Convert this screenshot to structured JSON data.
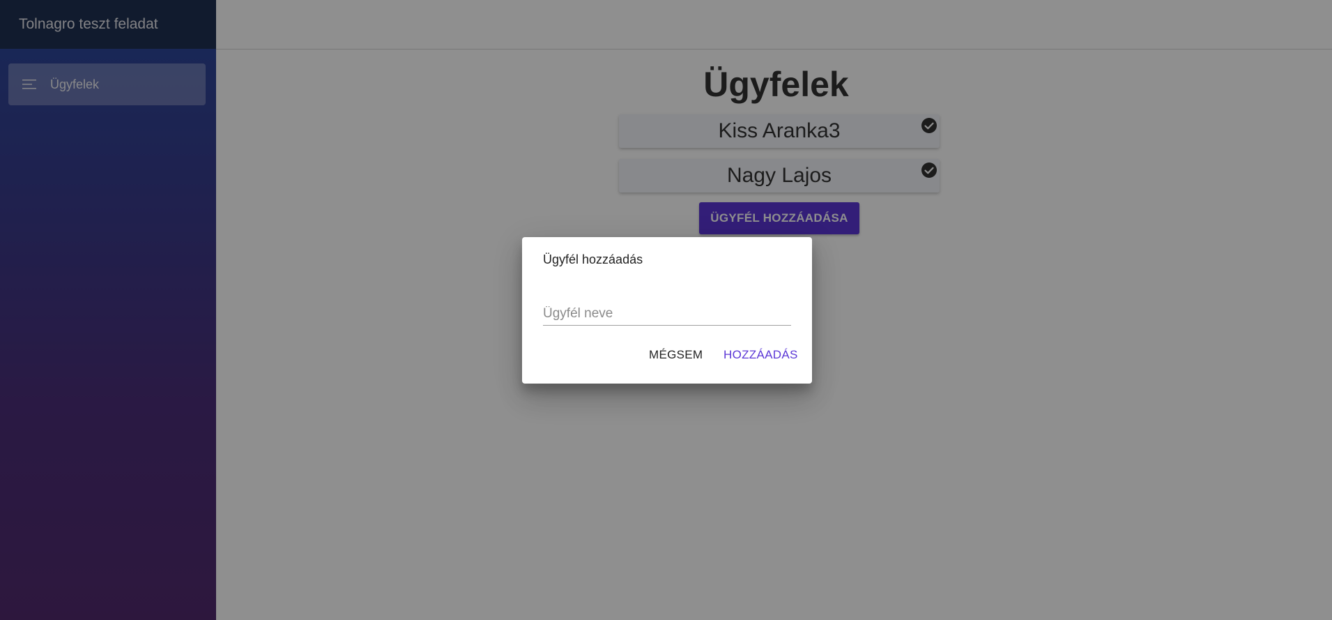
{
  "app": {
    "title": "Tolnagro teszt feladat"
  },
  "sidebar": {
    "items": [
      {
        "label": "Ügyfelek",
        "icon": "menu-icon"
      }
    ]
  },
  "main": {
    "page_title": "Ügyfelek",
    "clients": [
      {
        "name": "Kiss Aranka3",
        "icon": "check-circle-icon"
      },
      {
        "name": "Nagy Lajos",
        "icon": "check-circle-icon"
      }
    ],
    "add_button_label": "ÜGYFÉL HOZZÁADÁSA"
  },
  "dialog": {
    "title": "Ügyfél hozzáadás",
    "input_value": "",
    "input_placeholder": "Ügyfél neve",
    "cancel_label": "MÉGSEM",
    "confirm_label": "HOZZÁADÁS"
  },
  "colors": {
    "accent": "#5b37d6",
    "sidebar_header": "#1f3152",
    "overlay": "rgba(0,0,0,0.44)"
  }
}
